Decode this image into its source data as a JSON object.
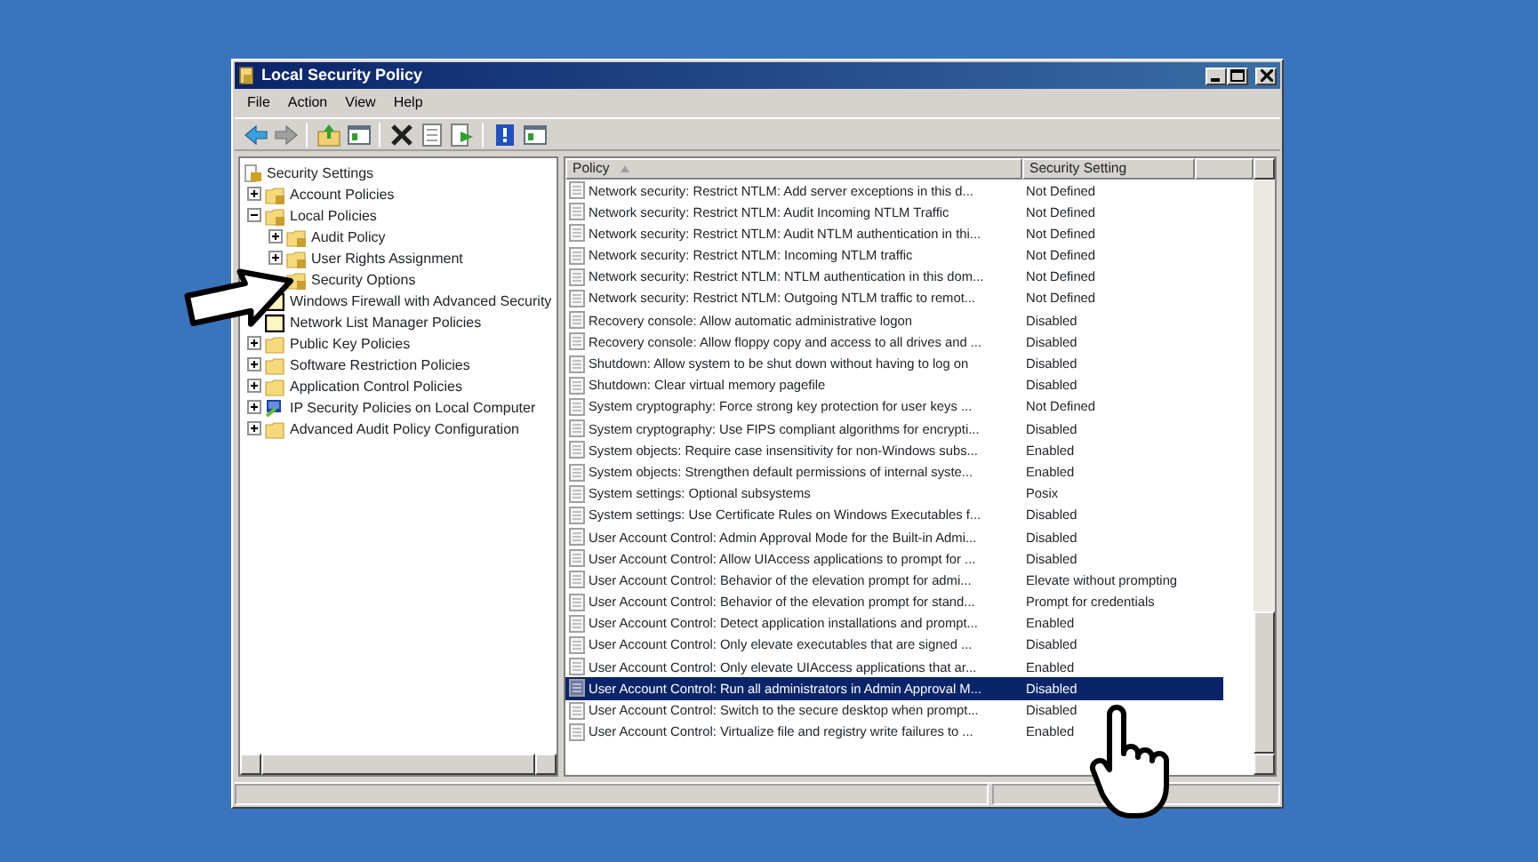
{
  "window": {
    "title": "Local Security Policy"
  },
  "menu": [
    "File",
    "Action",
    "View",
    "Help"
  ],
  "toolbar": [
    {
      "kind": "back"
    },
    {
      "kind": "forward"
    },
    {
      "kind": "sep"
    },
    {
      "kind": "up"
    },
    {
      "kind": "pane"
    },
    {
      "kind": "sep"
    },
    {
      "kind": "delete"
    },
    {
      "kind": "properties"
    },
    {
      "kind": "export"
    },
    {
      "kind": "sep"
    },
    {
      "kind": "help"
    },
    {
      "kind": "pane"
    }
  ],
  "tree": [
    {
      "label": "Security Settings",
      "kind": "root",
      "selected": false,
      "children": [
        {
          "label": "Account Policies",
          "kind": "locked-folder",
          "expanded": false,
          "selected": false
        },
        {
          "label": "Local Policies",
          "kind": "locked-folder",
          "expanded": true,
          "selected": false,
          "children": [
            {
              "label": "Audit Policy",
              "kind": "locked-folder",
              "expanded": false,
              "selected": false
            },
            {
              "label": "User Rights Assignment",
              "kind": "locked-folder",
              "expanded": false,
              "selected": false
            },
            {
              "label": "Security Options",
              "kind": "locked-folder",
              "selected": false
            }
          ]
        },
        {
          "label": "Windows Firewall with Advanced Security",
          "kind": "framed",
          "selected": false
        },
        {
          "label": "Network List Manager Policies",
          "kind": "framed",
          "selected": false
        },
        {
          "label": "Public Key Policies",
          "kind": "folder",
          "expanded": false,
          "selected": false
        },
        {
          "label": "Software Restriction Policies",
          "kind": "folder",
          "expanded": false,
          "selected": false
        },
        {
          "label": "Application Control Policies",
          "kind": "folder",
          "expanded": false,
          "selected": false
        },
        {
          "label": "IP Security Policies on Local Computer",
          "kind": "network",
          "expanded": false,
          "selected": false
        },
        {
          "label": "Advanced Audit Policy Configuration",
          "kind": "folder",
          "expanded": false,
          "selected": false
        }
      ]
    }
  ],
  "table": {
    "columns": [
      {
        "label": "Policy",
        "sorted": true
      },
      {
        "label": "Security Setting",
        "sorted": false
      }
    ],
    "rows": [
      {
        "policy": "Network security: Restrict NTLM: Add server exceptions in this d...",
        "setting": "Not Defined",
        "selected": false
      },
      {
        "policy": "Network security: Restrict NTLM: Audit Incoming NTLM Traffic",
        "setting": "Not Defined",
        "selected": false
      },
      {
        "policy": "Network security: Restrict NTLM: Audit NTLM authentication in thi...",
        "setting": "Not Defined",
        "selected": false
      },
      {
        "policy": "Network security: Restrict NTLM: Incoming NTLM traffic",
        "setting": "Not Defined",
        "selected": false
      },
      {
        "policy": "Network security: Restrict NTLM: NTLM authentication in this dom...",
        "setting": "Not Defined",
        "selected": false
      },
      {
        "policy": "Network security: Restrict NTLM: Outgoing NTLM traffic to remot...",
        "setting": "Not Defined",
        "selected": false
      },
      {
        "policy": "Recovery console: Allow automatic administrative logon",
        "setting": "Disabled",
        "selected": false
      },
      {
        "policy": "Recovery console: Allow floppy copy and access to all drives and ...",
        "setting": "Disabled",
        "selected": false
      },
      {
        "policy": "Shutdown: Allow system to be shut down without having to log on",
        "setting": "Disabled",
        "selected": false
      },
      {
        "policy": "Shutdown: Clear virtual memory pagefile",
        "setting": "Disabled",
        "selected": false
      },
      {
        "policy": "System cryptography: Force strong key protection for user keys ...",
        "setting": "Not Defined",
        "selected": false
      },
      {
        "policy": "System cryptography: Use FIPS compliant algorithms for encrypti...",
        "setting": "Disabled",
        "selected": false
      },
      {
        "policy": "System objects: Require case insensitivity for non-Windows subs...",
        "setting": "Enabled",
        "selected": false
      },
      {
        "policy": "System objects: Strengthen default permissions of internal syste...",
        "setting": "Enabled",
        "selected": false
      },
      {
        "policy": "System settings: Optional subsystems",
        "setting": "Posix",
        "selected": false
      },
      {
        "policy": "System settings: Use Certificate Rules on Windows Executables f...",
        "setting": "Disabled",
        "selected": false
      },
      {
        "policy": "User Account Control: Admin Approval Mode for the Built-in Admi...",
        "setting": "Disabled",
        "selected": false
      },
      {
        "policy": "User Account Control: Allow UIAccess applications to prompt for ...",
        "setting": "Disabled",
        "selected": false
      },
      {
        "policy": "User Account Control: Behavior of the elevation prompt for admi...",
        "setting": "Elevate without prompting",
        "selected": false
      },
      {
        "policy": "User Account Control: Behavior of the elevation prompt for stand...",
        "setting": "Prompt for credentials",
        "selected": false
      },
      {
        "policy": "User Account Control: Detect application installations and prompt...",
        "setting": "Enabled",
        "selected": false
      },
      {
        "policy": "User Account Control: Only elevate executables that are signed ...",
        "setting": "Disabled",
        "selected": false
      },
      {
        "policy": "User Account Control: Only elevate UIAccess applications that ar...",
        "setting": "Enabled",
        "selected": false
      },
      {
        "policy": "User Account Control: Run all administrators in Admin Approval M...",
        "setting": "Disabled",
        "selected": true
      },
      {
        "policy": "User Account Control: Switch to the secure desktop when prompt...",
        "setting": "Disabled",
        "selected": false
      },
      {
        "policy": "User Account Control: Virtualize file and registry write failures to ...",
        "setting": "Enabled",
        "selected": false
      }
    ]
  }
}
